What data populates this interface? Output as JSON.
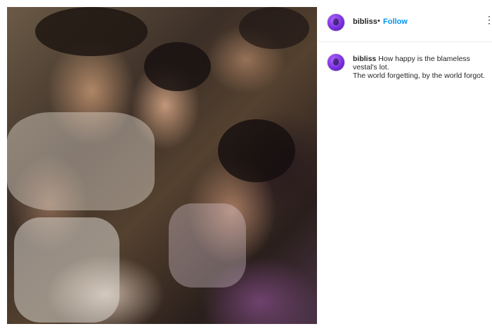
{
  "post": {
    "username": "bibliss",
    "separator": "•",
    "follow_label": "Follow",
    "more_label": "⋮",
    "caption": {
      "username": "bibliss",
      "line1": "How happy is the blameless vestal's lot.",
      "line2": "The world forgetting, by the world forgot."
    }
  },
  "icons": {
    "avatar": "user-avatar-icon",
    "more": "more-options-icon"
  },
  "colors": {
    "link": "#0095f6",
    "text": "#262626",
    "avatar": "#7a2fe0"
  }
}
